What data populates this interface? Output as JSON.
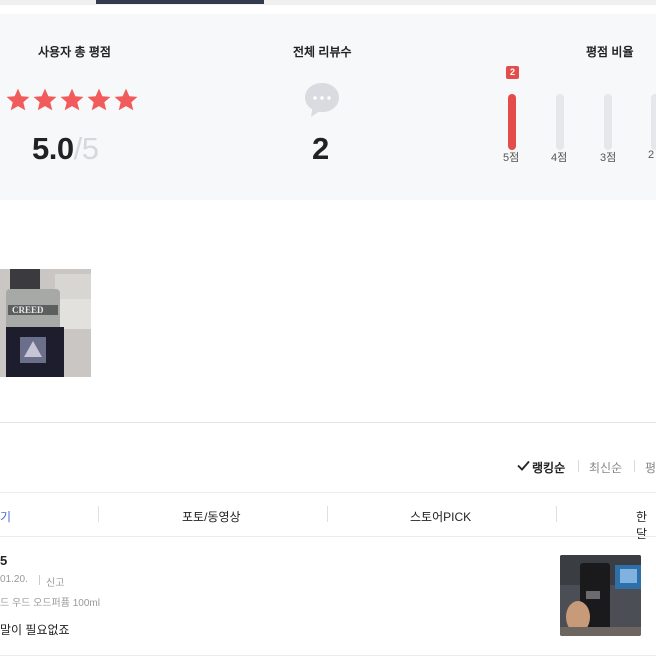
{
  "summary": {
    "rating_title": "사용자 총 평점",
    "rating_value": "5.0",
    "rating_max": "/5",
    "stars_filled": 5,
    "review_title": "전체 리뷰수",
    "review_count": "2",
    "ratio_title": "평점 비율",
    "ratio_bars": [
      {
        "label": "5점",
        "count": "2",
        "fraction": 1.0
      },
      {
        "label": "4점",
        "count": "",
        "fraction": 0
      },
      {
        "label": "3점",
        "count": "",
        "fraction": 0
      },
      {
        "label": "2",
        "count": "",
        "fraction": 0
      }
    ]
  },
  "sort": {
    "check_icon": "check-icon",
    "options": [
      "랭킹순",
      "최신순",
      "평"
    ]
  },
  "filter_tabs": [
    "기",
    "포토/동영상",
    "스토어PICK",
    "한달"
  ],
  "review": {
    "number": "5",
    "date": "01.20.",
    "report_label": "신고",
    "option": "드 우드 오드퍼퓸 100ml",
    "text": "말이 필요없죠"
  },
  "colors": {
    "accent": "#e44c4c",
    "star": "#f15b5b",
    "summary_bg": "#f7f8fa",
    "tab_active": "#333c4e"
  }
}
